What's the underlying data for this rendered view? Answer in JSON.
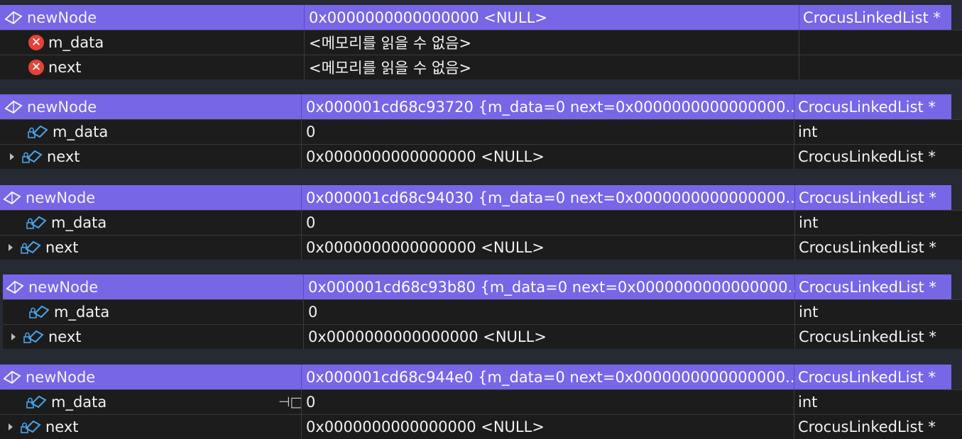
{
  "watch_blocks": [
    {
      "header": {
        "name": "newNode",
        "value": "0x0000000000000000 <NULL>",
        "type": "CrocusLinkedList *"
      },
      "rows": [
        {
          "name": "m_data",
          "value": "<메모리를 읽을 수 없음>",
          "type": "",
          "icon": "error-icon"
        },
        {
          "name": "next",
          "value": "<메모리를 읽을 수 없음>",
          "type": "",
          "icon": "error-icon"
        }
      ]
    },
    {
      "header": {
        "name": "newNode",
        "value": "0x000001cd68c93720 {m_data=0 next=0x0000000000000000...",
        "type": "CrocusLinkedList *"
      },
      "rows": [
        {
          "name": "m_data",
          "value": "0",
          "type": "int",
          "icon": "private-field-icon"
        },
        {
          "name": "next",
          "value": "0x0000000000000000 <NULL>",
          "type": "CrocusLinkedList *",
          "icon": "private-field-icon"
        }
      ]
    },
    {
      "header": {
        "name": "newNode",
        "value": "0x000001cd68c94030 {m_data=0 next=0x0000000000000000...",
        "type": "CrocusLinkedList *"
      },
      "rows": [
        {
          "name": "m_data",
          "value": "0",
          "type": "int",
          "icon": "private-field-icon"
        },
        {
          "name": "next",
          "value": "0x0000000000000000 <NULL>",
          "type": "CrocusLinkedList *",
          "icon": "private-field-icon"
        }
      ]
    },
    {
      "header": {
        "name": "newNode",
        "value": "0x000001cd68c93b80 {m_data=0 next=0x0000000000000000...",
        "type": "CrocusLinkedList *"
      },
      "rows": [
        {
          "name": "m_data",
          "value": "0",
          "type": "int",
          "icon": "private-field-icon"
        },
        {
          "name": "next",
          "value": "0x0000000000000000 <NULL>",
          "type": "CrocusLinkedList *",
          "icon": "private-field-icon"
        }
      ]
    },
    {
      "header": {
        "name": "newNode",
        "value": "0x000001cd68c944e0 {m_data=0 next=0x0000000000000000...",
        "type": "CrocusLinkedList *"
      },
      "rows": [
        {
          "name": "m_data",
          "value": "0",
          "type": "int",
          "icon": "private-field-icon"
        },
        {
          "name": "next",
          "value": "0x0000000000000000 <NULL>",
          "type": "CrocusLinkedList *",
          "icon": "private-field-icon"
        }
      ]
    }
  ],
  "error_glyph": "✕",
  "pin_glyph": "⊣□",
  "colors": {
    "header_bg": "#7766e6",
    "row_bg": "#1c1c1c",
    "page_bg": "#252a33",
    "error": "#e6423a",
    "icon_blue": "#4aa3e8"
  }
}
